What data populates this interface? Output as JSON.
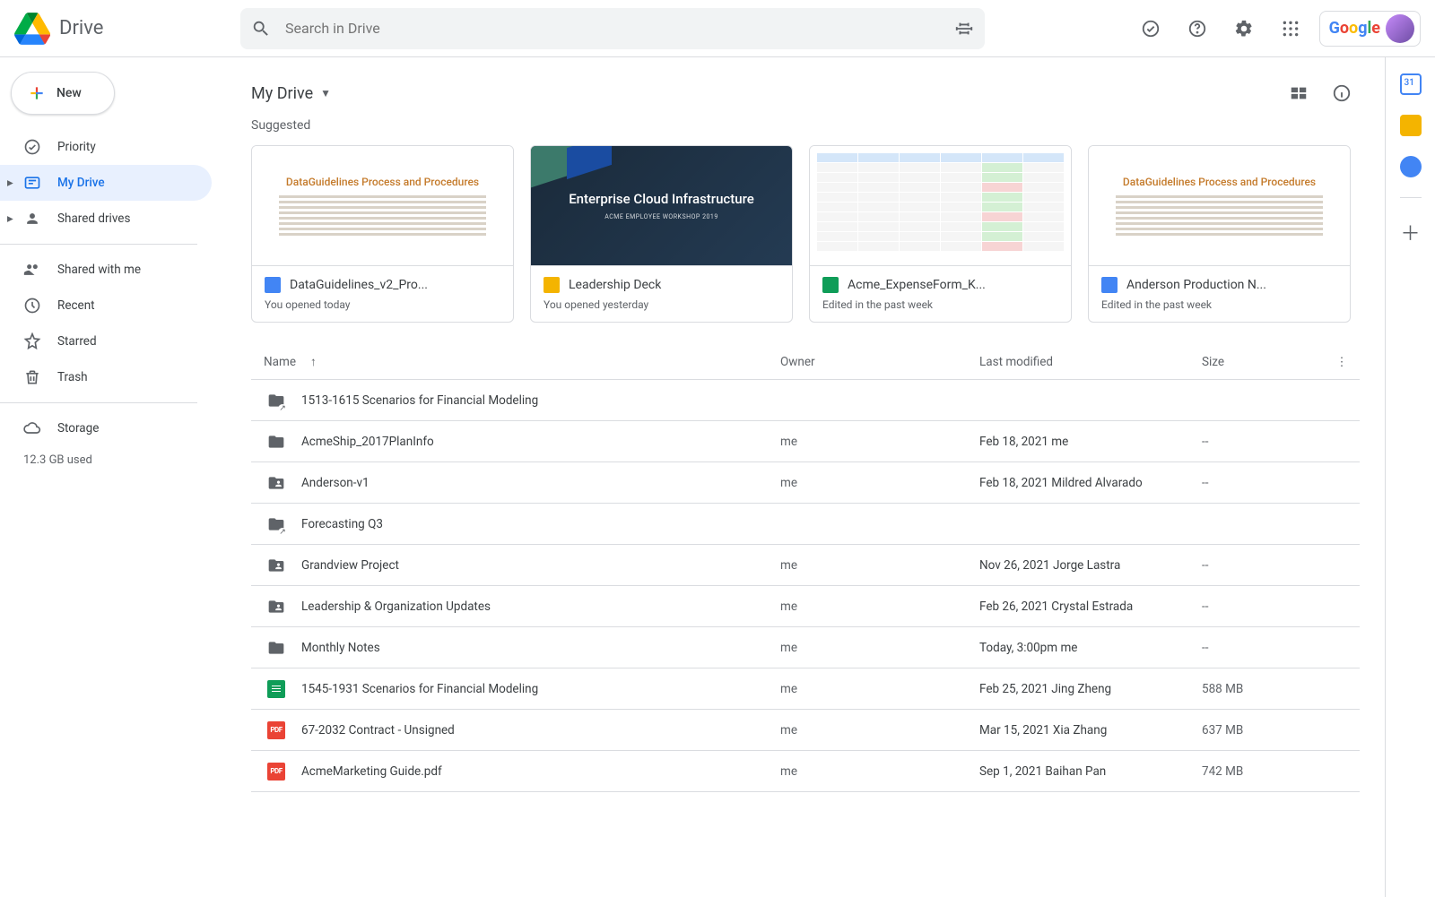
{
  "brand": {
    "name": "Drive",
    "chip": "Google"
  },
  "search": {
    "placeholder": "Search in Drive"
  },
  "newButton": {
    "label": "New"
  },
  "nav": {
    "priority": "Priority",
    "myDrive": "My Drive",
    "sharedDrives": "Shared drives",
    "sharedWithMe": "Shared with me",
    "recent": "Recent",
    "starred": "Starred",
    "trash": "Trash",
    "storage": "Storage",
    "storageUsed": "12.3 GB used"
  },
  "location": "My Drive",
  "suggestedLabel": "Suggested",
  "cards": [
    {
      "icon": "docs",
      "title": "DataGuidelines_v2_Pro...",
      "sub": "You opened today",
      "thumbTitle": "DataGuidelines Process and Procedures"
    },
    {
      "icon": "slides",
      "title": "Leadership Deck",
      "sub": "You opened yesterday",
      "thumbTitle": "Enterprise Cloud Infrastructure",
      "thumbSub": "ACME EMPLOYEE WORKSHOP 2019"
    },
    {
      "icon": "sheets",
      "title": "Acme_ExpenseForm_K...",
      "sub": "Edited in the past week"
    },
    {
      "icon": "docs",
      "title": "Anderson Production N...",
      "sub": "Edited in the past week",
      "thumbTitle": "DataGuidelines Process and Procedures"
    }
  ],
  "columns": {
    "name": "Name",
    "owner": "Owner",
    "modified": "Last modified",
    "size": "Size"
  },
  "rows": [
    {
      "type": "shortcut",
      "name": "1513-1615 Scenarios for Financial Modeling",
      "owner": "",
      "modified": "",
      "size": ""
    },
    {
      "type": "folder",
      "name": "AcmeShip_2017PlanInfo",
      "owner": "me",
      "modified": "Feb 18, 2021 me",
      "size": "--"
    },
    {
      "type": "folder-shared",
      "name": "Anderson-v1",
      "owner": "me",
      "modified": "Feb 18, 2021 Mildred Alvarado",
      "size": "--"
    },
    {
      "type": "shortcut",
      "name": "Forecasting Q3",
      "owner": "",
      "modified": "",
      "size": ""
    },
    {
      "type": "folder-shared",
      "name": "Grandview Project",
      "owner": "me",
      "modified": "Nov 26, 2021 Jorge Lastra",
      "size": "--"
    },
    {
      "type": "folder-shared",
      "name": "Leadership & Organization Updates",
      "owner": "me",
      "modified": "Feb 26, 2021 Crystal Estrada",
      "size": "--"
    },
    {
      "type": "folder",
      "name": "Monthly Notes",
      "owner": "me",
      "modified": "Today, 3:00pm me",
      "size": "--"
    },
    {
      "type": "sheet",
      "name": "1545-1931 Scenarios for Financial Modeling",
      "owner": "me",
      "modified": "Feb 25, 2021 Jing Zheng",
      "size": "588 MB"
    },
    {
      "type": "pdf",
      "name": "67-2032 Contract - Unsigned",
      "owner": "me",
      "modified": "Mar 15, 2021 Xia Zhang",
      "size": "637 MB"
    },
    {
      "type": "pdf",
      "name": "AcmeMarketing Guide.pdf",
      "owner": "me",
      "modified": "Sep 1, 2021 Baihan Pan",
      "size": "742 MB"
    }
  ]
}
